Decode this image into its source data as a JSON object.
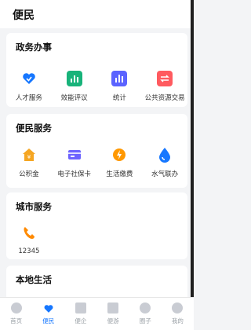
{
  "header": {
    "title": "便民"
  },
  "sections": {
    "gov": {
      "title": "政务办事",
      "items": [
        {
          "label": "人才服务",
          "icon": "heart-icon",
          "color": "#1677ff"
        },
        {
          "label": "效能评议",
          "icon": "bar-chart-icon",
          "color": "#18b37a"
        },
        {
          "label": "统计",
          "icon": "statistics-icon",
          "color": "#5b63ff"
        },
        {
          "label": "公共资源交易",
          "icon": "exchange-icon",
          "color": "#ff5a5f"
        }
      ]
    },
    "convenience": {
      "title": "便民服务",
      "items": [
        {
          "label": "公积金",
          "icon": "house-fund-icon",
          "color": "#f5a623"
        },
        {
          "label": "电子社保卡",
          "icon": "social-security-card-icon",
          "color": "#6c63ff"
        },
        {
          "label": "生活缴费",
          "icon": "payment-icon",
          "color": "#ff9800"
        },
        {
          "label": "水气联办",
          "icon": "water-drop-icon",
          "color": "#1677ff"
        }
      ]
    },
    "city": {
      "title": "城市服务",
      "items": [
        {
          "label": "12345",
          "icon": "phone-icon",
          "color": "#ff8a00"
        }
      ]
    },
    "local": {
      "title": "本地生活"
    }
  },
  "tabbar": [
    {
      "label": "首页",
      "icon": "home-icon",
      "active": false
    },
    {
      "label": "便民",
      "icon": "heart-icon",
      "active": true
    },
    {
      "label": "便企",
      "icon": "enterprise-icon",
      "active": false
    },
    {
      "label": "便游",
      "icon": "travel-icon",
      "active": false
    },
    {
      "label": "圈子",
      "icon": "community-icon",
      "active": false
    },
    {
      "label": "我的",
      "icon": "profile-icon",
      "active": false
    }
  ]
}
